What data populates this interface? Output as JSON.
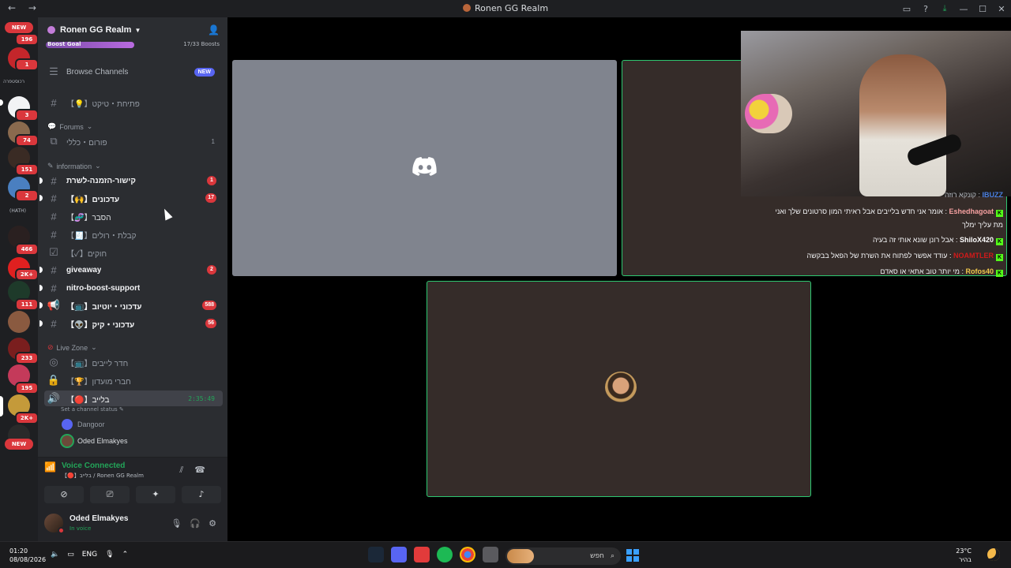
{
  "window": {
    "title": "Ronen GG Realm",
    "nav_arrows": "← →"
  },
  "rail": {
    "new_top": "NEW",
    "new_bottom": "NEW",
    "badges": [
      "196",
      "1",
      "3",
      "74",
      "151",
      "2",
      "466",
      "2K+",
      "111",
      "233",
      "195",
      "2K+"
    ],
    "labels": [
      "רכוסטפרה",
      "(HATH)"
    ]
  },
  "server": {
    "name": "Ronen GG Realm",
    "boost_label": "Boost Goal",
    "boost_count": "17/33 Boosts"
  },
  "channels": {
    "browse": "Browse Channels",
    "browse_badge": "NEW",
    "ticket": "【💡】פתיחת・טיקט",
    "forums_cat": "Forums",
    "forum": "פורום・כללי",
    "forum_count": "1",
    "info_cat": "information",
    "ch1": "קישור-הזמנה-לשרת",
    "ch1_badge": "1",
    "ch2": "【🙌】עדכונים",
    "ch2_badge": "17",
    "ch3": "【🧬】הסבר",
    "ch4": "【🧾】קבלת・רולים",
    "ch5": "【✓】חוקים",
    "ch6": "giveaway",
    "ch6_badge": "2",
    "ch7": "nitro-boost-support",
    "ch8": "【📺】עדכוני・יוטיוב",
    "ch8_badge": "588",
    "ch9": "【👽】עדכוני・קיק",
    "ch9_badge": "56",
    "live_cat": "Live Zone",
    "lv1": "【📺】חדר לייבים",
    "lv2": "【🏆】חברי מועדון",
    "lv3": "【🔴】בלייב",
    "lv3_timer": "2:35:49",
    "status": "Set a channel status",
    "vu1": "Dangoor",
    "vu2": "Oded Elmakyes"
  },
  "voice": {
    "title": "Voice Connected",
    "sub": "【🔴】בלייב / Ronen GG Realm"
  },
  "user": {
    "name": "Oded Elmakyes",
    "status": "In voice"
  },
  "chat": {
    "l1_user": "IBUZZ",
    "l1_text": "קונקא רוזה",
    "l2_user": "Eshedhagoat",
    "l2_text": "אומר אני חדש בלייבים אבל ראיתי המון סרטונים שלך ואני",
    "l2b_text": "מת עליך ימלך",
    "l3_user": "ShiloX420",
    "l3_text": "אבל רונן שונא אותי זה בעיה",
    "l4_user": "NOAMTLER",
    "l4_text": "עודד אפשר לפתוח את השרת של הפאל בבקשה",
    "l5_user": "Rofos40",
    "l5_text": "מי יותר טוב אתאי או סאדם"
  },
  "taskbar": {
    "time": "01:20",
    "date": "08/08/2026",
    "lang": "ENG",
    "search": "חפש",
    "temp": "23°C",
    "weather": "בהיר"
  },
  "colors": {
    "accent": "#5865f2",
    "green": "#23a559",
    "red": "#da373c",
    "kick": "#53fc18"
  }
}
